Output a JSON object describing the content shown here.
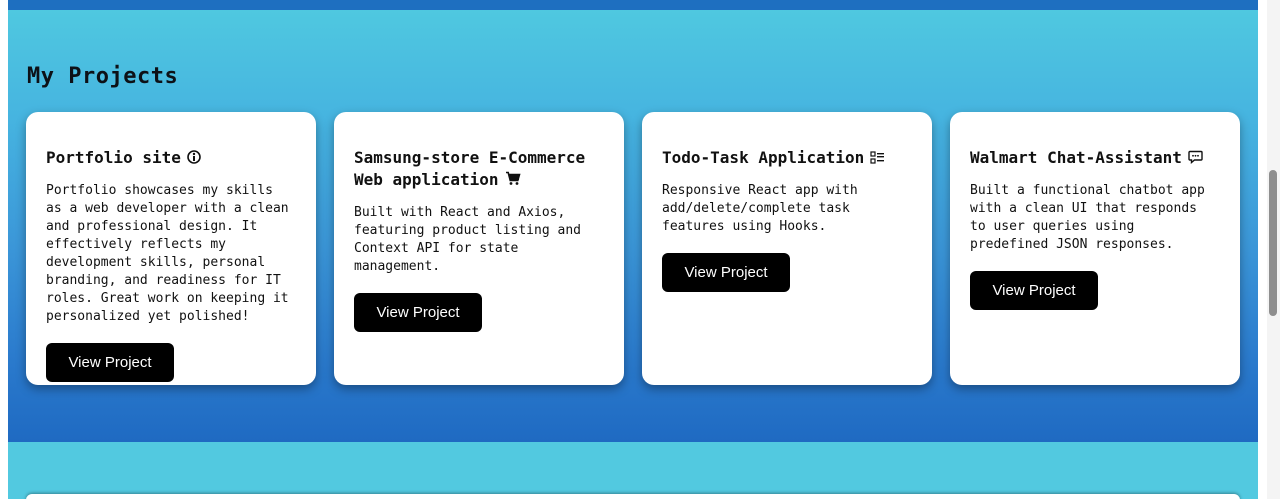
{
  "section": {
    "title": "My Projects"
  },
  "projects": [
    {
      "title": "Portfolio site",
      "icon": "info-circle-icon",
      "description": "Portfolio showcases my skills as a web developer with a clean and professional design. It effectively reflects my development skills, personal branding, and readiness for IT roles. Great work on keeping it personalized yet polished!",
      "button_label": "View Project"
    },
    {
      "title": "Samsung-store E-Commerce Web application",
      "icon": "shopping-cart-icon",
      "description": "Built with React and Axios, featuring product listing and Context API for state management.",
      "button_label": "View Project"
    },
    {
      "title": "Todo-Task Application",
      "icon": "checklist-icon",
      "description": "Responsive React app with add/delete/complete task features using Hooks.",
      "button_label": "View Project"
    },
    {
      "title": "Walmart Chat-Assistant",
      "icon": "chat-bubble-icon",
      "description": "Built a functional chatbot app with a clean UI that responds to user queries using predefined JSON responses.",
      "button_label": "View Project"
    }
  ],
  "colors": {
    "section_top": "#4fc8e0",
    "section_bottom": "#1f6ac2",
    "topbar": "#1e6fc0",
    "button_bg": "#000000",
    "card_bg": "#ffffff"
  }
}
